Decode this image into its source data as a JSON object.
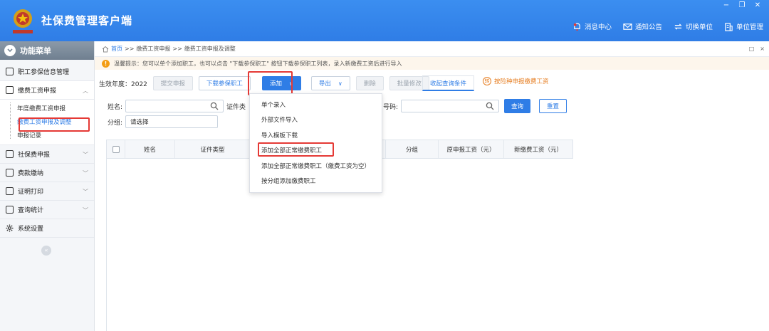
{
  "app": {
    "title": "社保费管理客户端",
    "accent": "#2f7de6",
    "highlight": "#e53935"
  },
  "window_controls": {
    "minimize": "−",
    "restore": "❐",
    "close": "✕"
  },
  "top_nav": [
    {
      "label": "消息中心",
      "icon": "bell-icon"
    },
    {
      "label": "通知公告",
      "icon": "mail-icon"
    },
    {
      "label": "切换单位",
      "icon": "switch-icon"
    },
    {
      "label": "单位管理",
      "icon": "building-icon"
    }
  ],
  "sidebar": {
    "header": "功能菜单",
    "items": [
      {
        "label": "职工参保信息管理",
        "icon": "person-card-icon"
      },
      {
        "label": "缴费工资申报",
        "icon": "edit-icon"
      },
      {
        "label": "社保费申报",
        "icon": "document-icon"
      },
      {
        "label": "费款缴纳",
        "icon": "wallet-icon"
      },
      {
        "label": "证明打印",
        "icon": "print-icon"
      },
      {
        "label": "查询统计",
        "icon": "chart-icon"
      },
      {
        "label": "系统设置",
        "icon": "gear-icon"
      }
    ],
    "sub_items": [
      "年度缴费工资申报",
      "缴费工资申报及调整",
      "申报记录"
    ],
    "collapse": "«"
  },
  "breadcrumb": {
    "home": "首页",
    "sep1": ">>",
    "level1": "缴费工资申报",
    "sep2": ">>",
    "level2": "缴费工资申报及调整"
  },
  "pane_controls": {
    "restore": "□",
    "close": "×"
  },
  "tip": {
    "icon": "!",
    "text": "温馨提示：您可以单个添加职工，也可以点击 \"下载参保职工\" 按钮下载参保职工列表，录入新缴费工资后进行导入"
  },
  "toolbar": {
    "year_label": "生效年度：2022",
    "submit": "提交申报",
    "download": "下载参保职工",
    "add": "添加",
    "export": "导出",
    "delete": "删除",
    "batch_edit": "批量修改",
    "collapse_query": "收起查询条件",
    "by_category": "按险种申报缴费工资",
    "by_category_icon": "转"
  },
  "search": {
    "name_label": "姓名:",
    "id_type_label": "证件类",
    "number_label": "号码:",
    "group_label": "分组:",
    "group_placeholder": "请选择",
    "query": "查询",
    "reset": "重置"
  },
  "table": {
    "columns": [
      "姓名",
      "证件类型",
      "分组",
      "原申报工资（元）",
      "新缴费工资（元）"
    ]
  },
  "add_menu": [
    "单个录入",
    "外部文件导入",
    "导入模板下载",
    "添加全部正常缴费职工",
    "添加全部正常缴费职工（缴费工资为空）",
    "按分组添加缴费职工"
  ]
}
